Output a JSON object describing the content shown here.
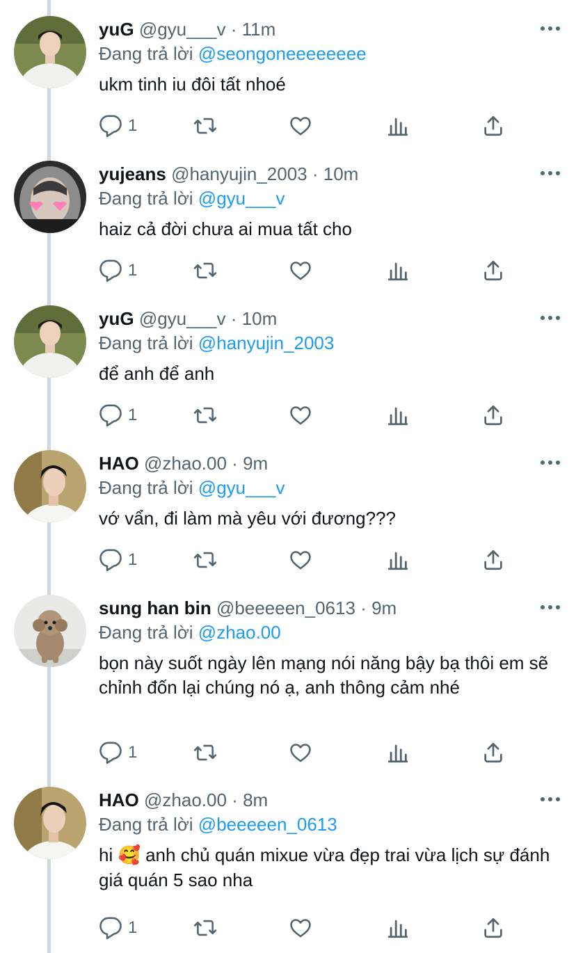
{
  "replying_prefix": "Đang trả lời",
  "colors": {
    "accent": "#1d9bf0",
    "secondary_text": "#536471",
    "thread_line": "#cfd9de"
  },
  "tweets": [
    {
      "display_name": "yuG",
      "handle": "@gyu___v",
      "separator": "·",
      "time": "11m",
      "replying_to": "@seongoneeeeeeee",
      "text": "ukm tinh iu đôi tất nhoé",
      "reply_count": "1",
      "avatar": "boy-in-white-shirt"
    },
    {
      "display_name": "yujeans",
      "handle": "@hanyujin_2003",
      "separator": "·",
      "time": "10m",
      "replying_to": "@gyu___v",
      "text": "haiz cả đời chưa ai mua tất cho",
      "reply_count": "1",
      "avatar": "hooded-person-with-heart-glasses"
    },
    {
      "display_name": "yuG",
      "handle": "@gyu___v",
      "separator": "·",
      "time": "10m",
      "replying_to": "@hanyujin_2003",
      "text": "để anh để anh",
      "reply_count": "1",
      "avatar": "boy-in-white-shirt"
    },
    {
      "display_name": "HAO",
      "handle": "@zhao.00",
      "separator": "·",
      "time": "9m",
      "replying_to": "@gyu___v",
      "text": "vớ vẩn, đi làm mà yêu với đương???",
      "reply_count": "1",
      "avatar": "boy-profile-portrait"
    },
    {
      "display_name": "sung han bin",
      "handle": "@beeeeen_0613",
      "separator": "·",
      "time": "9m",
      "replying_to": "@zhao.00",
      "text": "bọn này suốt ngày lên mạng nói năng bậy bạ thôi em sẽ chỉnh đốn lại chúng nó ạ, anh thông cảm nhé",
      "reply_count": "1",
      "avatar": "poodle-dog"
    },
    {
      "display_name": "HAO",
      "handle": "@zhao.00",
      "separator": "·",
      "time": "8m",
      "replying_to": "@beeeeen_0613",
      "text_emoji": "🥰",
      "text": "anh chủ quán mixue vừa đẹp trai vừa lịch sự đánh giá quán 5 sao nha",
      "text_lead": "hi",
      "reply_count": "1",
      "avatar": "boy-profile-portrait"
    }
  ]
}
